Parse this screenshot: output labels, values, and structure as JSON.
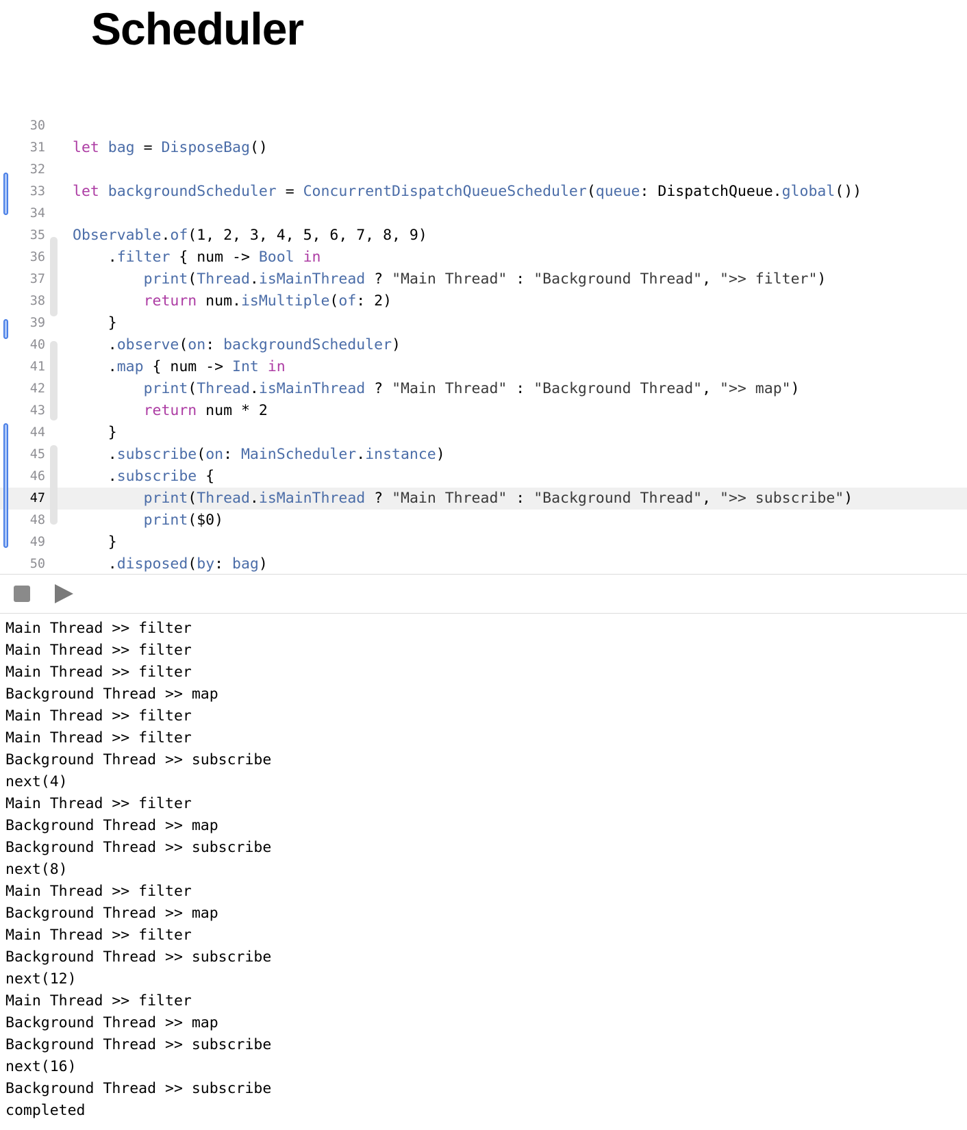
{
  "page_title": "Scheduler",
  "editor": {
    "active_line": 47,
    "lines": [
      {
        "n": "30",
        "tokens": []
      },
      {
        "n": "31",
        "tokens": [
          [
            "kw",
            "let"
          ],
          [
            "pl",
            " "
          ],
          [
            "tp",
            "bag"
          ],
          [
            "pl",
            " = "
          ],
          [
            "fn",
            "DisposeBag"
          ],
          [
            "pl",
            "()"
          ]
        ]
      },
      {
        "n": "32",
        "tokens": []
      },
      {
        "n": "33",
        "tokens": [
          [
            "kw",
            "let"
          ],
          [
            "pl",
            " "
          ],
          [
            "tp",
            "backgroundScheduler"
          ],
          [
            "pl",
            " = "
          ],
          [
            "fn",
            "ConcurrentDispatchQueueScheduler"
          ],
          [
            "pl",
            "("
          ],
          [
            "fn",
            "queue"
          ],
          [
            "pl",
            ": DispatchQueue."
          ],
          [
            "fn",
            "global"
          ],
          [
            "pl",
            "())"
          ]
        ]
      },
      {
        "n": "34",
        "tokens": []
      },
      {
        "n": "35",
        "tokens": [
          [
            "fn",
            "Observable"
          ],
          [
            "pl",
            "."
          ],
          [
            "fn",
            "of"
          ],
          [
            "pl",
            "(1, 2, 3, 4, 5, 6, 7, 8, 9)"
          ]
        ]
      },
      {
        "n": "36",
        "tokens": [
          [
            "pl",
            "    ."
          ],
          [
            "fn",
            "filter"
          ],
          [
            "pl",
            " { num -> "
          ],
          [
            "fn",
            "Bool"
          ],
          [
            "pl",
            " "
          ],
          [
            "kw",
            "in"
          ]
        ]
      },
      {
        "n": "37",
        "tokens": [
          [
            "pl",
            "        "
          ],
          [
            "fn",
            "print"
          ],
          [
            "pl",
            "("
          ],
          [
            "fn",
            "Thread"
          ],
          [
            "pl",
            "."
          ],
          [
            "fn",
            "isMainThread"
          ],
          [
            "pl",
            " ? "
          ],
          [
            "st",
            "\"Main Thread\""
          ],
          [
            "pl",
            " : "
          ],
          [
            "st",
            "\"Background Thread\""
          ],
          [
            "pl",
            ", "
          ],
          [
            "st",
            "\">> filter\""
          ],
          [
            "pl",
            ")"
          ]
        ]
      },
      {
        "n": "38",
        "tokens": [
          [
            "pl",
            "        "
          ],
          [
            "kw",
            "return"
          ],
          [
            "pl",
            " num."
          ],
          [
            "fn",
            "isMultiple"
          ],
          [
            "pl",
            "("
          ],
          [
            "fn",
            "of"
          ],
          [
            "pl",
            ": 2)"
          ]
        ]
      },
      {
        "n": "39",
        "tokens": [
          [
            "pl",
            "    }"
          ]
        ]
      },
      {
        "n": "40",
        "tokens": [
          [
            "pl",
            "    ."
          ],
          [
            "fn",
            "observe"
          ],
          [
            "pl",
            "("
          ],
          [
            "fn",
            "on"
          ],
          [
            "pl",
            ": "
          ],
          [
            "tp",
            "backgroundScheduler"
          ],
          [
            "pl",
            ")"
          ]
        ]
      },
      {
        "n": "41",
        "tokens": [
          [
            "pl",
            "    ."
          ],
          [
            "fn",
            "map"
          ],
          [
            "pl",
            " { num -> "
          ],
          [
            "fn",
            "Int"
          ],
          [
            "pl",
            " "
          ],
          [
            "kw",
            "in"
          ]
        ]
      },
      {
        "n": "42",
        "tokens": [
          [
            "pl",
            "        "
          ],
          [
            "fn",
            "print"
          ],
          [
            "pl",
            "("
          ],
          [
            "fn",
            "Thread"
          ],
          [
            "pl",
            "."
          ],
          [
            "fn",
            "isMainThread"
          ],
          [
            "pl",
            " ? "
          ],
          [
            "st",
            "\"Main Thread\""
          ],
          [
            "pl",
            " : "
          ],
          [
            "st",
            "\"Background Thread\""
          ],
          [
            "pl",
            ", "
          ],
          [
            "st",
            "\">> map\""
          ],
          [
            "pl",
            ")"
          ]
        ]
      },
      {
        "n": "43",
        "tokens": [
          [
            "pl",
            "        "
          ],
          [
            "kw",
            "return"
          ],
          [
            "pl",
            " num * 2"
          ]
        ]
      },
      {
        "n": "44",
        "tokens": [
          [
            "pl",
            "    }"
          ]
        ]
      },
      {
        "n": "45",
        "tokens": [
          [
            "pl",
            "    ."
          ],
          [
            "fn",
            "subscribe"
          ],
          [
            "pl",
            "("
          ],
          [
            "fn",
            "on"
          ],
          [
            "pl",
            ": "
          ],
          [
            "fn",
            "MainScheduler"
          ],
          [
            "pl",
            "."
          ],
          [
            "fn",
            "instance"
          ],
          [
            "pl",
            ")"
          ]
        ]
      },
      {
        "n": "46",
        "tokens": [
          [
            "pl",
            "    ."
          ],
          [
            "fn",
            "subscribe"
          ],
          [
            "pl",
            " {"
          ]
        ]
      },
      {
        "n": "47",
        "tokens": [
          [
            "pl",
            "        "
          ],
          [
            "fn",
            "print"
          ],
          [
            "pl",
            "("
          ],
          [
            "fn",
            "Thread"
          ],
          [
            "pl",
            "."
          ],
          [
            "fn",
            "isMainThread"
          ],
          [
            "pl",
            " ? "
          ],
          [
            "st",
            "\"Main Thread\""
          ],
          [
            "pl",
            " : "
          ],
          [
            "st",
            "\"Background Thread\""
          ],
          [
            "pl",
            ", "
          ],
          [
            "st",
            "\">> subscribe\""
          ],
          [
            "pl",
            ")"
          ]
        ]
      },
      {
        "n": "48",
        "tokens": [
          [
            "pl",
            "        "
          ],
          [
            "fn",
            "print"
          ],
          [
            "pl",
            "($0)"
          ]
        ]
      },
      {
        "n": "49",
        "tokens": [
          [
            "pl",
            "    }"
          ]
        ]
      },
      {
        "n": "50",
        "tokens": [
          [
            "pl",
            "    ."
          ],
          [
            "fn",
            "disposed"
          ],
          [
            "pl",
            "("
          ],
          [
            "fn",
            "by"
          ],
          [
            "pl",
            ": "
          ],
          [
            "tp",
            "bag"
          ],
          [
            "pl",
            ")"
          ]
        ]
      }
    ]
  },
  "console": {
    "lines": [
      "Main Thread >> filter",
      "Main Thread >> filter",
      "Main Thread >> filter",
      "Background Thread >> map",
      "Main Thread >> filter",
      "Main Thread >> filter",
      "Background Thread >> subscribe",
      "next(4)",
      "Main Thread >> filter",
      "Background Thread >> map",
      "Background Thread >> subscribe",
      "next(8)",
      "Main Thread >> filter",
      "Background Thread >> map",
      "Main Thread >> filter",
      "Background Thread >> subscribe",
      "next(12)",
      "Main Thread >> filter",
      "Background Thread >> map",
      "Background Thread >> subscribe",
      "next(16)",
      "Background Thread >> subscribe",
      "completed"
    ]
  }
}
